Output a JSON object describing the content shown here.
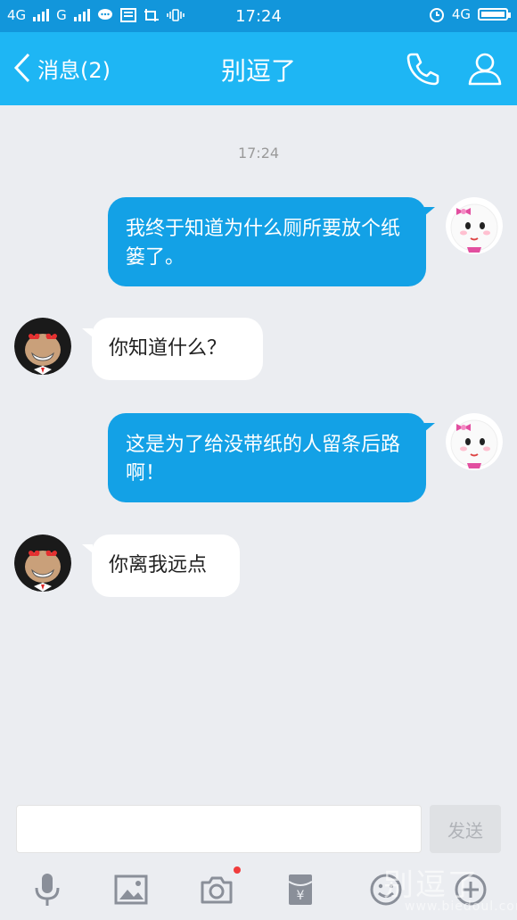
{
  "status_bar": {
    "network1": "4G",
    "network2": "G",
    "time": "17:24",
    "network3": "4G"
  },
  "header": {
    "back_label": "消息(2)",
    "title": "别逗了"
  },
  "chat": {
    "timestamp": "17:24",
    "messages": [
      {
        "sender": "me",
        "text": "我终于知道为什么厕所要放个纸篓了。"
      },
      {
        "sender": "other",
        "text": "你知道什么？"
      },
      {
        "sender": "me",
        "text": "这是为了给没带纸的人留条后路啊！"
      },
      {
        "sender": "other",
        "text": "你离我远点"
      }
    ]
  },
  "input_bar": {
    "placeholder": "",
    "send_label": "发送"
  },
  "toolbar": {
    "items": [
      "microphone-icon",
      "image-icon",
      "camera-icon",
      "red-packet-icon",
      "emoji-icon",
      "plus-icon"
    ]
  },
  "watermark": {
    "text": "别逗了",
    "url": "www.biedoul.com"
  },
  "colors": {
    "status_bar": "#1296db",
    "title_bar": "#1eb6f4",
    "outgoing_bubble": "#13a1e6",
    "incoming_bubble": "#ffffff",
    "background": "#ebedf1"
  }
}
